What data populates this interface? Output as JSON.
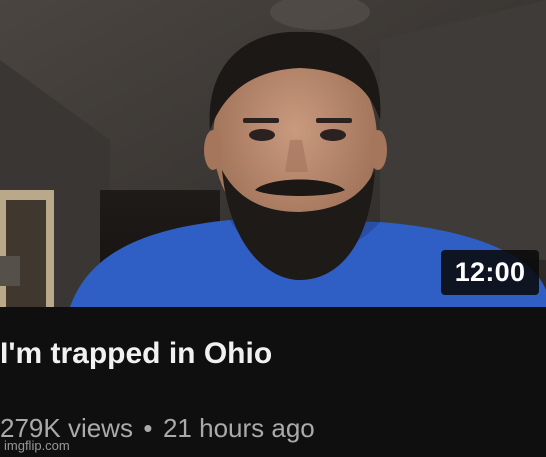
{
  "video": {
    "title": "I'm trapped in Ohio",
    "duration": "12:00",
    "views": "279K views",
    "separator": "•",
    "age": "21 hours ago",
    "thumbnail_subject": "man-selfie-icon"
  },
  "watermark": {
    "text": "imgflip.com"
  },
  "colors": {
    "background": "#0f0f0f",
    "title": "#f1f1f1",
    "meta": "#aaaaaa",
    "badge": "#0a0a0a",
    "shirt": "#2f5fc4"
  }
}
